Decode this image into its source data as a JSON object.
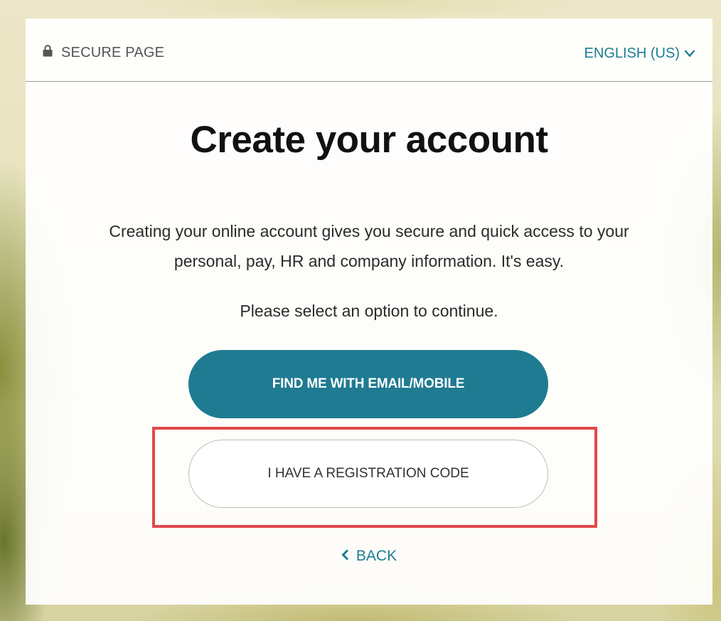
{
  "header": {
    "secure_label": "SECURE PAGE",
    "language_label": "ENGLISH (US)"
  },
  "main": {
    "title": "Create your account",
    "intro_line1": "Creating your online account gives you secure and quick access to your",
    "intro_line2": "personal, pay, HR and company information. It's easy.",
    "select_prompt": "Please select an option to continue.",
    "primary_button": "FIND ME WITH EMAIL/MOBILE",
    "secondary_button": "I HAVE A REGISTRATION CODE",
    "back_label": "BACK"
  },
  "icons": {
    "secure": "lock-icon",
    "language": "chevron-down-icon",
    "back": "chevron-left-icon"
  },
  "colors": {
    "accent": "#1f7b92",
    "link": "#1c7d93",
    "highlight": "#e04848"
  }
}
